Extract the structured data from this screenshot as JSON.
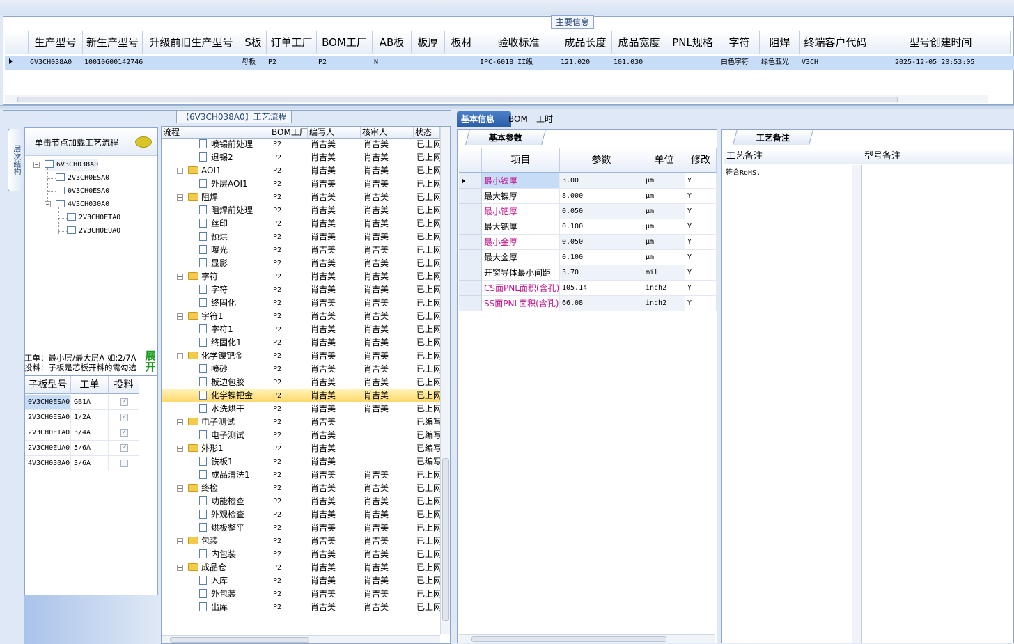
{
  "main_info": {
    "title": "主要信息",
    "columns": [
      "生产型号",
      "新生产型号",
      "升级前旧生产型号",
      "S板",
      "订单工厂",
      "BOM工厂",
      "AB板",
      "板厚",
      "板材",
      "验收标准",
      "成品长度",
      "成品宽度",
      "PNL规格",
      "字符",
      "阻焊",
      "终端客户代码",
      "型号创建时间"
    ],
    "row": [
      "6V3CH038A0",
      "10010600142746",
      "",
      "母板",
      "P2",
      "P2",
      "N",
      "",
      "",
      "IPC-6018 II级",
      "121.020",
      "101.030",
      "",
      "白色字符",
      "绿色亚光",
      "V3CH",
      "2025-12-05 20:53:05"
    ]
  },
  "left": {
    "panel_title": "【6V3CH038A0】工艺流程",
    "vertical_tab": "层次结构",
    "tree_hint": "单击节点加载工艺流程",
    "tree": [
      {
        "label": "6V3CH038A0",
        "level": 0
      },
      {
        "label": "2V3CH0ESA0",
        "level": 1
      },
      {
        "label": "0V3CH0ESA0",
        "level": 1
      },
      {
        "label": "4V3CH030A0",
        "level": 1
      },
      {
        "label": "2V3CH0ETA0",
        "level": 2
      },
      {
        "label": "2V3CH0EUA0",
        "level": 2
      }
    ],
    "tip1": "工单：最小层/最大层A 如:2/7A",
    "tip2": "投料：子板是芯板开料的需勾选",
    "expand_label": "展开",
    "sub_columns": [
      "子板型号",
      "工单",
      "投料"
    ],
    "sub_rows": [
      {
        "model": "0V3CH0ESA0",
        "order": "GB1A",
        "checked": true
      },
      {
        "model": "2V3CH0ESA0",
        "order": "1/2A",
        "checked": true
      },
      {
        "model": "2V3CH0ETA0",
        "order": "3/4A",
        "checked": true
      },
      {
        "model": "2V3CH0EUA0",
        "order": "5/6A",
        "checked": true
      },
      {
        "model": "4V3CH030A0",
        "order": "3/6A",
        "checked": false
      }
    ]
  },
  "flow": {
    "columns": [
      "流程",
      "BOM工厂",
      "编写人",
      "核审人",
      "状态"
    ],
    "rows": [
      {
        "name": "喷锡前处理",
        "type": "leaf",
        "bom": "P2",
        "writer": "肖吉美",
        "checker": "肖吉美",
        "status": "已上网"
      },
      {
        "name": "退锡2",
        "type": "leaf",
        "bom": "P2",
        "writer": "肖吉美",
        "checker": "肖吉美",
        "status": "已上网"
      },
      {
        "name": "AOI1",
        "type": "folder",
        "bom": "P2",
        "writer": "肖吉美",
        "checker": "肖吉美",
        "status": "已上网"
      },
      {
        "name": "外层AOI1",
        "type": "leaf",
        "bom": "P2",
        "writer": "肖吉美",
        "checker": "肖吉美",
        "status": "已上网"
      },
      {
        "name": "阻焊",
        "type": "folder",
        "bom": "P2",
        "writer": "肖吉美",
        "checker": "肖吉美",
        "status": "已上网"
      },
      {
        "name": "阻焊前处理",
        "type": "leaf",
        "bom": "P2",
        "writer": "肖吉美",
        "checker": "肖吉美",
        "status": "已上网"
      },
      {
        "name": "丝印",
        "type": "leaf",
        "bom": "P2",
        "writer": "肖吉美",
        "checker": "肖吉美",
        "status": "已上网"
      },
      {
        "name": "预烘",
        "type": "leaf",
        "bom": "P2",
        "writer": "肖吉美",
        "checker": "肖吉美",
        "status": "已上网"
      },
      {
        "name": "曝光",
        "type": "leaf",
        "bom": "P2",
        "writer": "肖吉美",
        "checker": "肖吉美",
        "status": "已上网"
      },
      {
        "name": "显影",
        "type": "leaf",
        "bom": "P2",
        "writer": "肖吉美",
        "checker": "肖吉美",
        "status": "已上网"
      },
      {
        "name": "字符",
        "type": "folder",
        "bom": "P2",
        "writer": "肖吉美",
        "checker": "肖吉美",
        "status": "已上网"
      },
      {
        "name": "字符",
        "type": "leaf",
        "bom": "P2",
        "writer": "肖吉美",
        "checker": "肖吉美",
        "status": "已上网"
      },
      {
        "name": "终固化",
        "type": "leaf",
        "bom": "P2",
        "writer": "肖吉美",
        "checker": "肖吉美",
        "status": "已上网"
      },
      {
        "name": "字符1",
        "type": "folder",
        "bom": "P2",
        "writer": "肖吉美",
        "checker": "肖吉美",
        "status": "已上网"
      },
      {
        "name": "字符1",
        "type": "leaf",
        "bom": "P2",
        "writer": "肖吉美",
        "checker": "肖吉美",
        "status": "已上网"
      },
      {
        "name": "终固化1",
        "type": "leaf",
        "bom": "P2",
        "writer": "肖吉美",
        "checker": "肖吉美",
        "status": "已上网"
      },
      {
        "name": "化学镍钯金",
        "type": "folder",
        "bom": "P2",
        "writer": "肖吉美",
        "checker": "肖吉美",
        "status": "已上网"
      },
      {
        "name": "喷砂",
        "type": "leaf",
        "bom": "P2",
        "writer": "肖吉美",
        "checker": "肖吉美",
        "status": "已上网"
      },
      {
        "name": "板边包胶",
        "type": "leaf",
        "bom": "P2",
        "writer": "肖吉美",
        "checker": "肖吉美",
        "status": "已上网"
      },
      {
        "name": "化学镍钯金",
        "type": "leaf",
        "bom": "P2",
        "writer": "肖吉美",
        "checker": "肖吉美",
        "status": "已上网",
        "selected": true
      },
      {
        "name": "水洗烘干",
        "type": "leaf",
        "bom": "P2",
        "writer": "肖吉美",
        "checker": "肖吉美",
        "status": "已上网"
      },
      {
        "name": "电子测试",
        "type": "folder",
        "bom": "P2",
        "writer": "肖吉美",
        "checker": "",
        "status": "已编写"
      },
      {
        "name": "电子测试",
        "type": "leaf",
        "bom": "P2",
        "writer": "肖吉美",
        "checker": "",
        "status": "已编写"
      },
      {
        "name": "外形1",
        "type": "folder",
        "bom": "P2",
        "writer": "肖吉美",
        "checker": "",
        "status": "已编写"
      },
      {
        "name": "铣板1",
        "type": "leaf",
        "bom": "P2",
        "writer": "肖吉美",
        "checker": "",
        "status": "已编写"
      },
      {
        "name": "成品清洗1",
        "type": "leaf",
        "bom": "P2",
        "writer": "肖吉美",
        "checker": "肖吉美",
        "status": "已上网"
      },
      {
        "name": "终检",
        "type": "folder",
        "bom": "P2",
        "writer": "肖吉美",
        "checker": "肖吉美",
        "status": "已上网"
      },
      {
        "name": "功能检查",
        "type": "leaf",
        "bom": "P2",
        "writer": "肖吉美",
        "checker": "肖吉美",
        "status": "已上网"
      },
      {
        "name": "外观检查",
        "type": "leaf",
        "bom": "P2",
        "writer": "肖吉美",
        "checker": "肖吉美",
        "status": "已上网"
      },
      {
        "name": "烘板整平",
        "type": "leaf",
        "bom": "P2",
        "writer": "肖吉美",
        "checker": "肖吉美",
        "status": "已上网"
      },
      {
        "name": "包装",
        "type": "folder",
        "bom": "P2",
        "writer": "肖吉美",
        "checker": "肖吉美",
        "status": "已上网"
      },
      {
        "name": "内包装",
        "type": "leaf",
        "bom": "P2",
        "writer": "肖吉美",
        "checker": "肖吉美",
        "status": "已上网"
      },
      {
        "name": "成品仓",
        "type": "folder",
        "bom": "P2",
        "writer": "肖吉美",
        "checker": "肖吉美",
        "status": "已上网"
      },
      {
        "name": "入库",
        "type": "leaf",
        "bom": "P2",
        "writer": "肖吉美",
        "checker": "肖吉美",
        "status": "已上网"
      },
      {
        "name": "外包装",
        "type": "leaf",
        "bom": "P2",
        "writer": "肖吉美",
        "checker": "肖吉美",
        "status": "已上网"
      },
      {
        "name": "出库",
        "type": "leaf",
        "bom": "P2",
        "writer": "肖吉美",
        "checker": "肖吉美",
        "status": "已上网"
      }
    ]
  },
  "right": {
    "tabs": [
      "基本信息",
      "BOM",
      "工时"
    ],
    "params_title": "基本参数",
    "param_columns": [
      "项目",
      "参数",
      "单位",
      "修改"
    ],
    "params": [
      {
        "item": "最小镍厚",
        "value": "3.00",
        "unit": "μm",
        "mod": "Y",
        "highlight": true
      },
      {
        "item": "最大镍厚",
        "value": "8.000",
        "unit": "μm",
        "mod": "Y",
        "highlight": false
      },
      {
        "item": "最小钯厚",
        "value": "0.050",
        "unit": "μm",
        "mod": "Y",
        "highlight": true
      },
      {
        "item": "最大钯厚",
        "value": "0.100",
        "unit": "μm",
        "mod": "Y",
        "highlight": false
      },
      {
        "item": "最小金厚",
        "value": "0.050",
        "unit": "μm",
        "mod": "Y",
        "highlight": true
      },
      {
        "item": "最大金厚",
        "value": "0.100",
        "unit": "μm",
        "mod": "Y",
        "highlight": false
      },
      {
        "item": "开窗导体最小间距",
        "value": "3.70",
        "unit": "mil",
        "mod": "Y",
        "highlight": false
      },
      {
        "item": "CS面PNL面积(含孔)",
        "value": "105.14",
        "unit": "inch2",
        "mod": "Y",
        "highlight": true
      },
      {
        "item": "SS面PNL面积(含孔)",
        "value": "66.08",
        "unit": "inch2",
        "mod": "Y",
        "highlight": true
      }
    ],
    "notes_title": "工艺备注",
    "notes_columns": [
      "工艺备注",
      "型号备注"
    ],
    "process_note": "符合RoHS.",
    "colors": {
      "highlight_text": "#c0148c",
      "tab_active": "#2a5ea8"
    }
  }
}
